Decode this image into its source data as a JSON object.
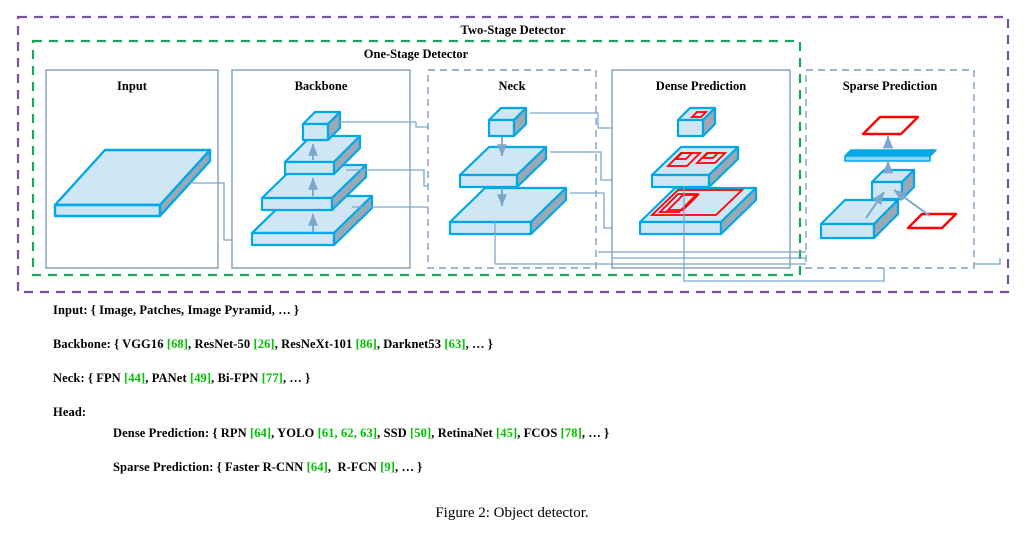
{
  "figure": {
    "caption": "Figure 2: Object detector.",
    "bands": [
      {
        "id": "two-stage",
        "label": "Two-Stage Detector",
        "color": "#7b4fa0",
        "style": "dashed"
      },
      {
        "id": "one-stage",
        "label": "One-Stage Detector",
        "color": "#14a85a",
        "style": "dashed"
      }
    ],
    "panels": [
      {
        "id": "input",
        "label": "Input",
        "border": "solid",
        "color": "#7d9ec0"
      },
      {
        "id": "backbone",
        "label": "Backbone",
        "border": "solid",
        "color": "#7d9ec0"
      },
      {
        "id": "neck",
        "label": "Neck",
        "border": "dashed",
        "color": "#7d9ec0"
      },
      {
        "id": "dense-prediction",
        "label": "Dense Prediction",
        "border": "solid",
        "color": "#7d9ec0"
      },
      {
        "id": "sparse-prediction",
        "label": "Sparse Prediction",
        "border": "dashed",
        "color": "#7d9ec0"
      }
    ],
    "palette": {
      "slab_fill": "#cfe7f5",
      "slab_stroke": "#00a8e8",
      "slab_side": "#9aa8b5",
      "bbox_red": "#ff0000",
      "connector": "#7ba7cf",
      "arrow": "#7ba7cf",
      "reference_green": "#00c000"
    }
  },
  "legend": {
    "lines": [
      {
        "id": "input",
        "indent": 0,
        "parts": [
          {
            "t": "Input: { Image, Patches, Image Pyramid, … }",
            "ref": false
          }
        ]
      },
      {
        "id": "backbone",
        "indent": 0,
        "parts": [
          {
            "t": "Backbone: { VGG16 ",
            "ref": false
          },
          {
            "t": "[68]",
            "ref": true
          },
          {
            "t": ", ResNet-50 ",
            "ref": false
          },
          {
            "t": "[26]",
            "ref": true
          },
          {
            "t": ", ResNeXt-101 ",
            "ref": false
          },
          {
            "t": "[86]",
            "ref": true
          },
          {
            "t": ", Darknet53 ",
            "ref": false
          },
          {
            "t": "[63]",
            "ref": true
          },
          {
            "t": ", … }",
            "ref": false
          }
        ]
      },
      {
        "id": "neck",
        "indent": 0,
        "parts": [
          {
            "t": "Neck: { FPN ",
            "ref": false
          },
          {
            "t": "[44]",
            "ref": true
          },
          {
            "t": ", PANet ",
            "ref": false
          },
          {
            "t": "[49]",
            "ref": true
          },
          {
            "t": ", Bi-FPN ",
            "ref": false
          },
          {
            "t": "[77]",
            "ref": true
          },
          {
            "t": ", … }",
            "ref": false
          }
        ]
      },
      {
        "id": "head",
        "indent": 0,
        "parts": [
          {
            "t": "Head:",
            "ref": false
          }
        ]
      },
      {
        "id": "dense-prediction",
        "indent": 60,
        "parts": [
          {
            "t": "Dense Prediction: { RPN ",
            "ref": false
          },
          {
            "t": "[64]",
            "ref": true
          },
          {
            "t": ", YOLO ",
            "ref": false
          },
          {
            "t": "[61, 62, 63]",
            "ref": true
          },
          {
            "t": ", SSD ",
            "ref": false
          },
          {
            "t": "[50]",
            "ref": true
          },
          {
            "t": ", RetinaNet ",
            "ref": false
          },
          {
            "t": "[45]",
            "ref": true
          },
          {
            "t": ", FCOS ",
            "ref": false
          },
          {
            "t": "[78]",
            "ref": true
          },
          {
            "t": ", … }",
            "ref": false
          }
        ]
      },
      {
        "id": "sparse-prediction",
        "indent": 60,
        "parts": [
          {
            "t": "Sparse Prediction: { Faster R-CNN ",
            "ref": false
          },
          {
            "t": "[64]",
            "ref": true
          },
          {
            "t": ",  R-FCN ",
            "ref": false
          },
          {
            "t": "[9]",
            "ref": true
          },
          {
            "t": ", … }",
            "ref": false
          }
        ]
      }
    ]
  }
}
